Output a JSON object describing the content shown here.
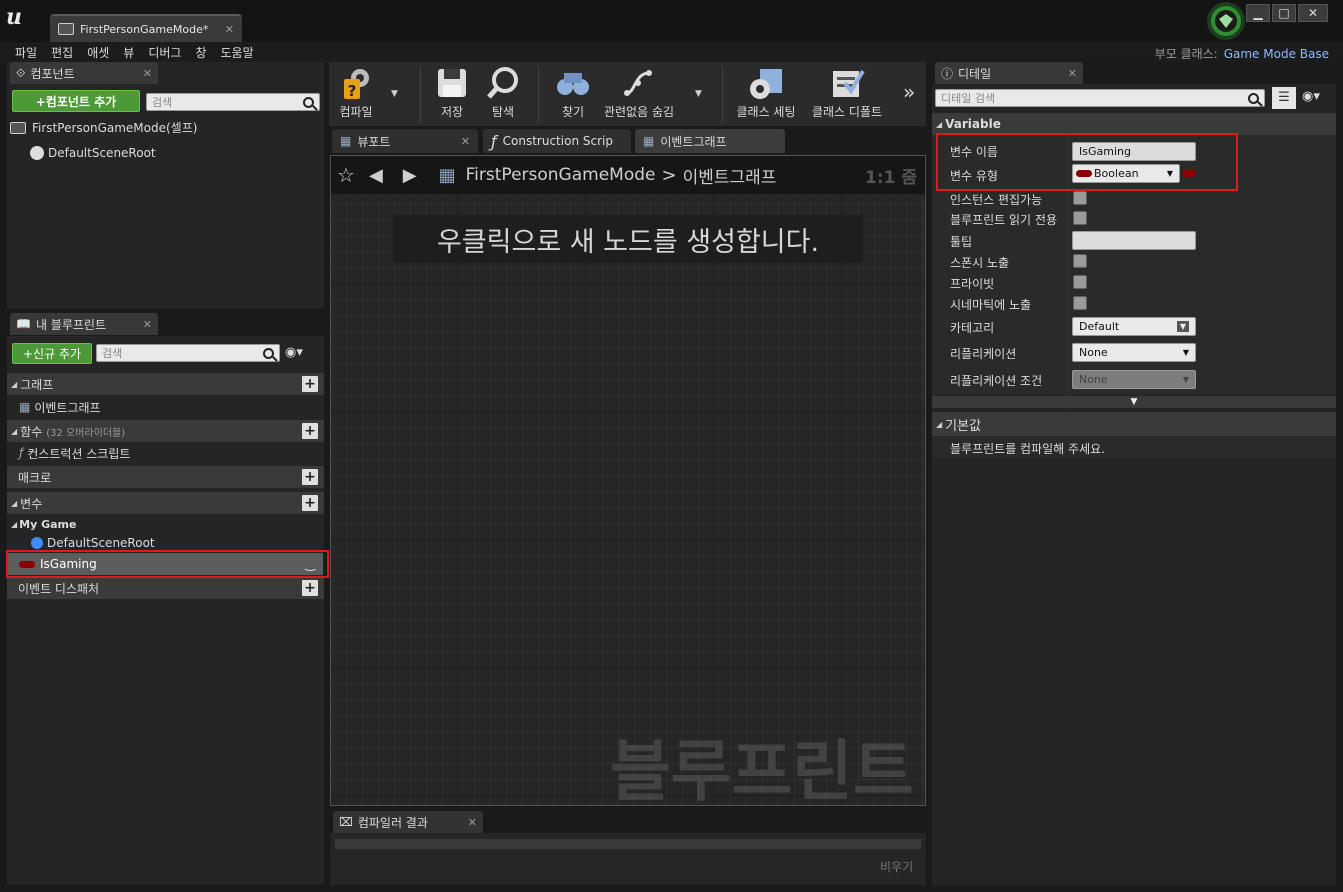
{
  "window": {
    "tab_title": "FirstPersonGameMode*",
    "parent_class_label": "부모 클래스:",
    "parent_class_value": "Game Mode Base"
  },
  "menu": [
    "파일",
    "편집",
    "애셋",
    "뷰",
    "디버그",
    "창",
    "도움말"
  ],
  "components": {
    "tab": "컴포넌트",
    "add_button": "+컴포넌트 추가",
    "search_placeholder": "검색",
    "items": [
      "FirstPersonGameMode(셀프)",
      "DefaultSceneRoot"
    ]
  },
  "my_blueprint": {
    "tab": "내 블루프린트",
    "add_new_button": "+신규 추가",
    "search_placeholder": "검색",
    "graphs_header": "그래프",
    "graphs_item": "이벤트그래프",
    "functions_header": "함수",
    "functions_overridable": "(32 오버라이더블)",
    "functions_item": "컨스트럭션 스크립트",
    "macros_header": "매크로",
    "variables_header": "변수",
    "variables_category": "My Game",
    "variables_items": [
      "DefaultSceneRoot",
      "IsGaming"
    ],
    "dispatchers_header": "이벤트 디스패처"
  },
  "toolbar": {
    "compile": "컴파일",
    "save": "저장",
    "browse": "탐색",
    "find": "찾기",
    "hide_unrelated": "관련없음 숨김",
    "class_settings": "클래스 세팅",
    "class_defaults": "클래스 디폴트",
    "more": "»"
  },
  "editor_tabs": [
    "뷰포트",
    "Construction Scrip",
    "이벤트그래프"
  ],
  "graph": {
    "breadcrumb_root": "FirstPersonGameMode",
    "breadcrumb_sep": ">",
    "breadcrumb_current": "이벤트그래프",
    "zoom": "1:1 줌",
    "hint": "우클릭으로 새 노드를 생성합니다.",
    "watermark": "블루프린트"
  },
  "compiler": {
    "tab": "컴파일러 결과",
    "clear_button": "비우기"
  },
  "details": {
    "tab": "디테일",
    "search_placeholder": "디테일 검색",
    "section_variable": "Variable",
    "var_name_label": "변수 이름",
    "var_name_value": "IsGaming",
    "var_type_label": "변수 유형",
    "var_type_value": "Boolean",
    "instance_editable": "인스턴스 편집가능",
    "bp_readonly": "블루프린트 읽기 전용",
    "tooltip": "툴팁",
    "expose_on_spawn": "스폰시 노출",
    "private": "프라이빗",
    "expose_cinematics": "시네마틱에 노출",
    "category_label": "카테고리",
    "category_value": "Default",
    "replication_label": "리플리케이션",
    "replication_value": "None",
    "rep_condition_label": "리플리케이션 조건",
    "rep_condition_value": "None",
    "section_default": "기본값",
    "default_msg": "블루프린트를 컴파일해 주세요."
  },
  "colors": {
    "accent_green": "#4c9a37",
    "highlight_red": "#e01a1a",
    "bool_pin": "#8b0000",
    "link_blue": "#8fb9ff"
  },
  "icons": [
    "unreal-logo-icon",
    "blueprint-doc-icon",
    "close-icon",
    "compile-icon",
    "save-icon",
    "browse-icon",
    "find-icon",
    "hide-unrelated-icon",
    "class-settings-icon",
    "class-defaults-icon",
    "star-icon",
    "back-arrow-icon",
    "forward-arrow-icon",
    "search-icon",
    "eye-icon",
    "details-info-icon"
  ]
}
